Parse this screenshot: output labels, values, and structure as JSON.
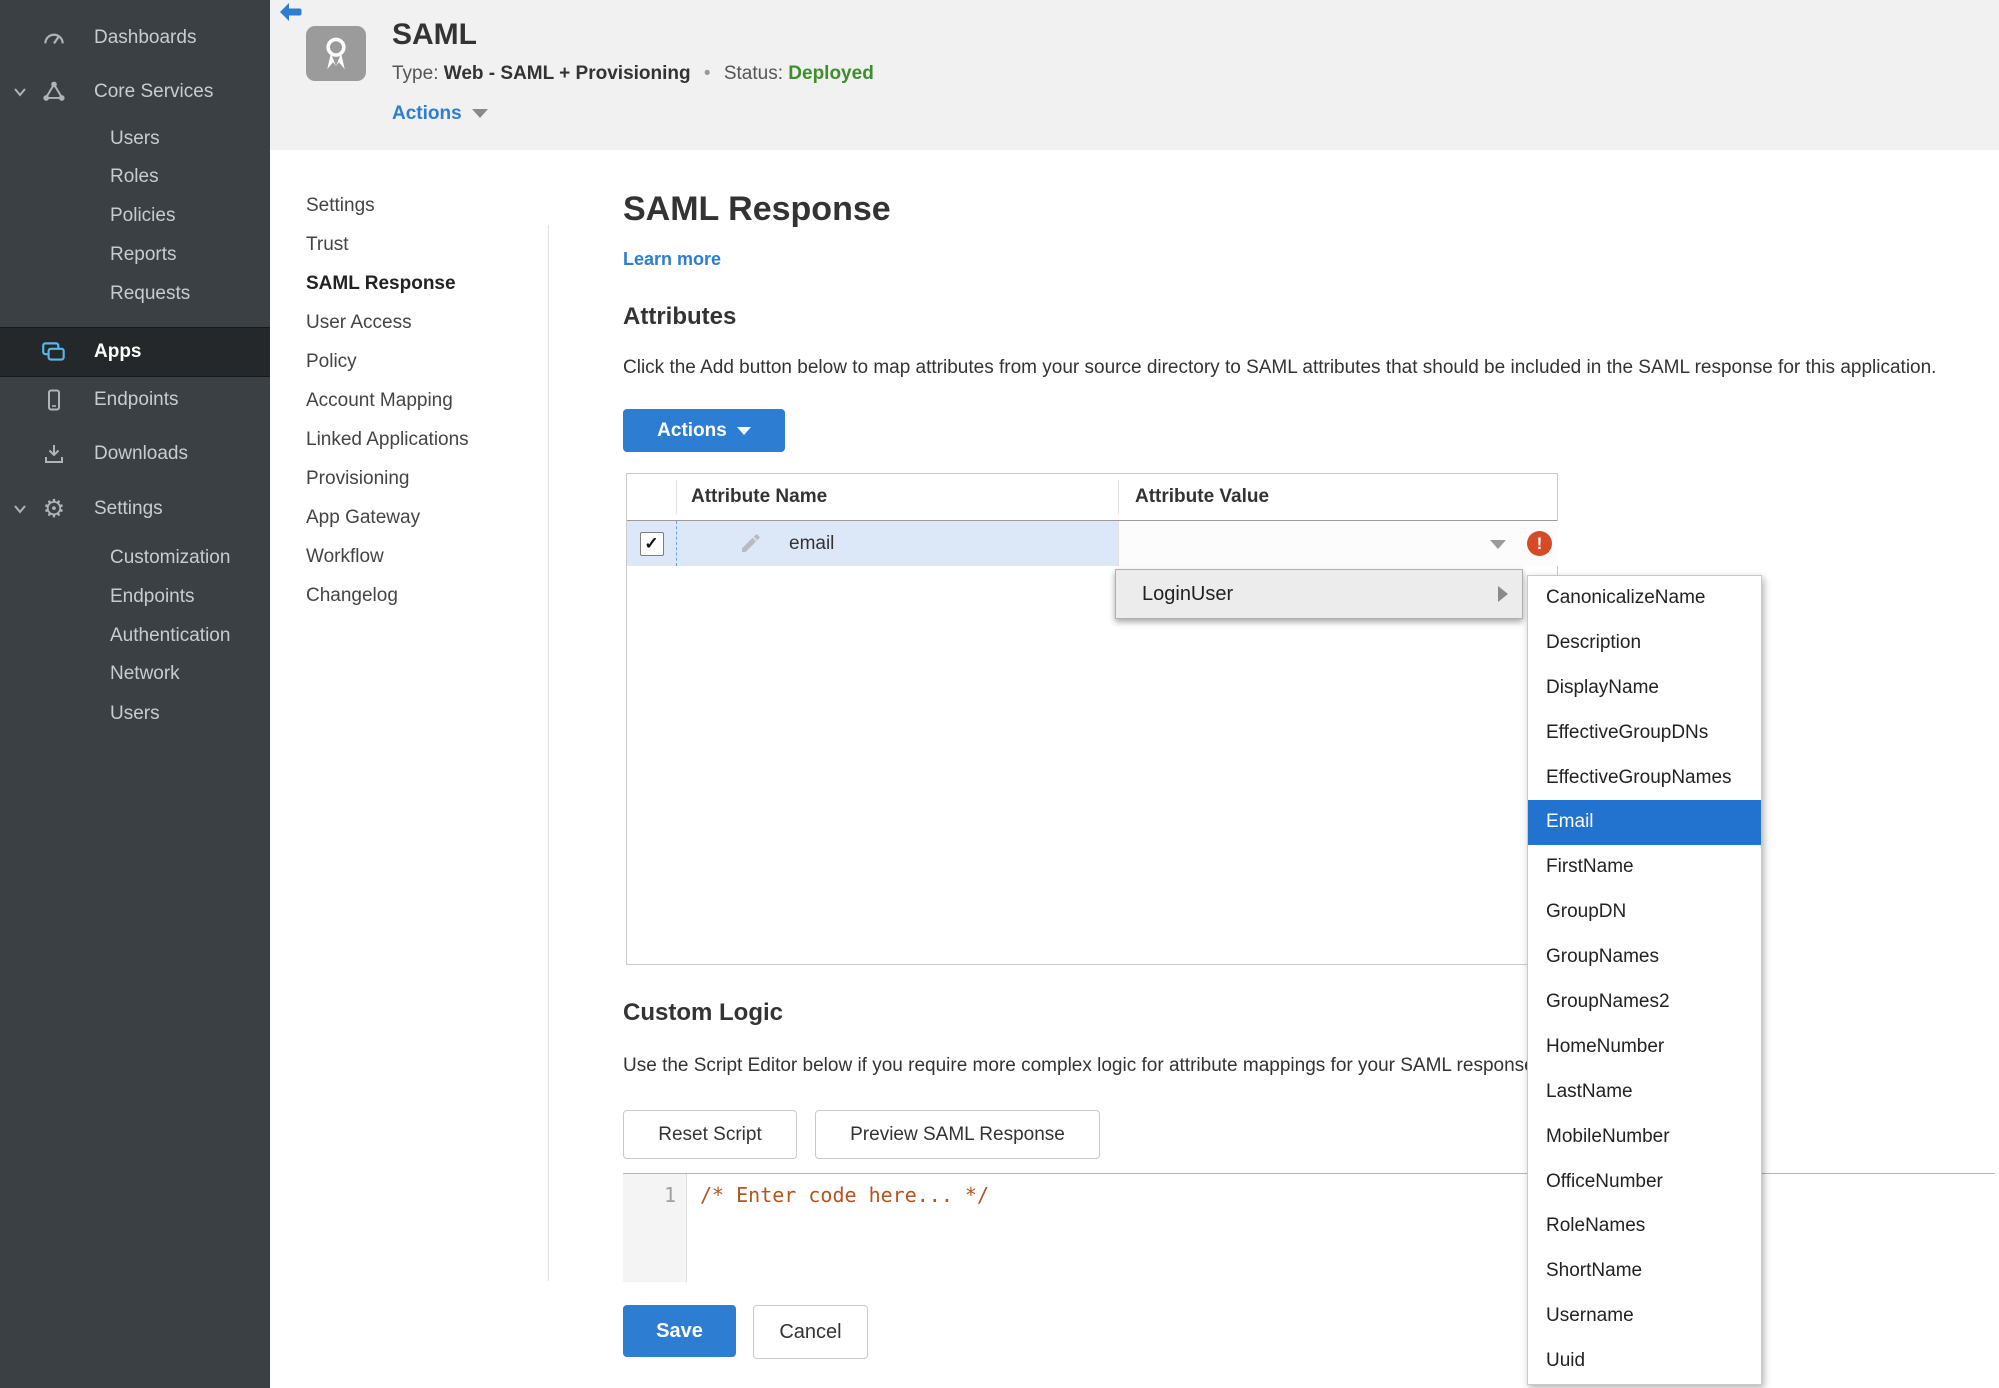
{
  "colors": {
    "accent_blue": "#2d7dd2",
    "status_green": "#3e8e2e",
    "error_red": "#d64a28",
    "row_blue": "#dce8f8",
    "sidebar_bg": "#3b4045",
    "sidebar_active_bg": "#24282b",
    "code_orange": "#b5541f",
    "submenu_selected": "#2272d0"
  },
  "icons": {
    "gear": "⚙",
    "check": "✓",
    "exclamation": "!"
  },
  "sidebar": {
    "items": [
      {
        "label": "Dashboards"
      },
      {
        "label": "Core Services"
      },
      {
        "label": "Users"
      },
      {
        "label": "Roles"
      },
      {
        "label": "Policies"
      },
      {
        "label": "Reports"
      },
      {
        "label": "Requests"
      },
      {
        "label": "Apps"
      },
      {
        "label": "Endpoints"
      },
      {
        "label": "Downloads"
      },
      {
        "label": "Settings"
      },
      {
        "label": "Customization"
      },
      {
        "label": "Endpoints"
      },
      {
        "label": "Authentication"
      },
      {
        "label": "Network"
      },
      {
        "label": "Users"
      }
    ]
  },
  "app": {
    "title": "SAML",
    "type_label": "Type:",
    "type_value": "Web - SAML + Provisioning",
    "separator": "•",
    "status_label": "Status:",
    "status_value": "Deployed",
    "actions_label": "Actions"
  },
  "subnav": {
    "items": [
      "Settings",
      "Trust",
      "SAML Response",
      "User Access",
      "Policy",
      "Account Mapping",
      "Linked Applications",
      "Provisioning",
      "App Gateway",
      "Workflow",
      "Changelog"
    ],
    "active": "SAML Response"
  },
  "main": {
    "title": "SAML Response",
    "learn_more": "Learn more",
    "attributes": {
      "heading": "Attributes",
      "description": "Click the Add button below to map attributes from your source directory to SAML attributes that should be included in the SAML response for this application.",
      "actions_button": "Actions",
      "table": {
        "columns": [
          "Attribute Name",
          "Attribute Value"
        ],
        "rows": [
          {
            "name": "email",
            "value": "",
            "checked": true,
            "error": true
          }
        ]
      }
    },
    "value_menu": {
      "parent": "LoginUser",
      "selected": "Email",
      "items": [
        "CanonicalizeName",
        "Description",
        "DisplayName",
        "EffectiveGroupDNs",
        "EffectiveGroupNames",
        "Email",
        "FirstName",
        "GroupDN",
        "GroupNames",
        "GroupNames2",
        "HomeNumber",
        "LastName",
        "MobileNumber",
        "OfficeNumber",
        "RoleNames",
        "ShortName",
        "Username",
        "Uuid"
      ]
    },
    "custom_logic": {
      "heading": "Custom Logic",
      "description": "Use the Script Editor below if you require more complex logic for attribute mappings for your SAML response.",
      "reset_button": "Reset Script",
      "preview_button": "Preview SAML Response",
      "editor": {
        "line_number": "1",
        "code": "/* Enter code here... */"
      }
    },
    "footer": {
      "save": "Save",
      "cancel": "Cancel"
    }
  }
}
